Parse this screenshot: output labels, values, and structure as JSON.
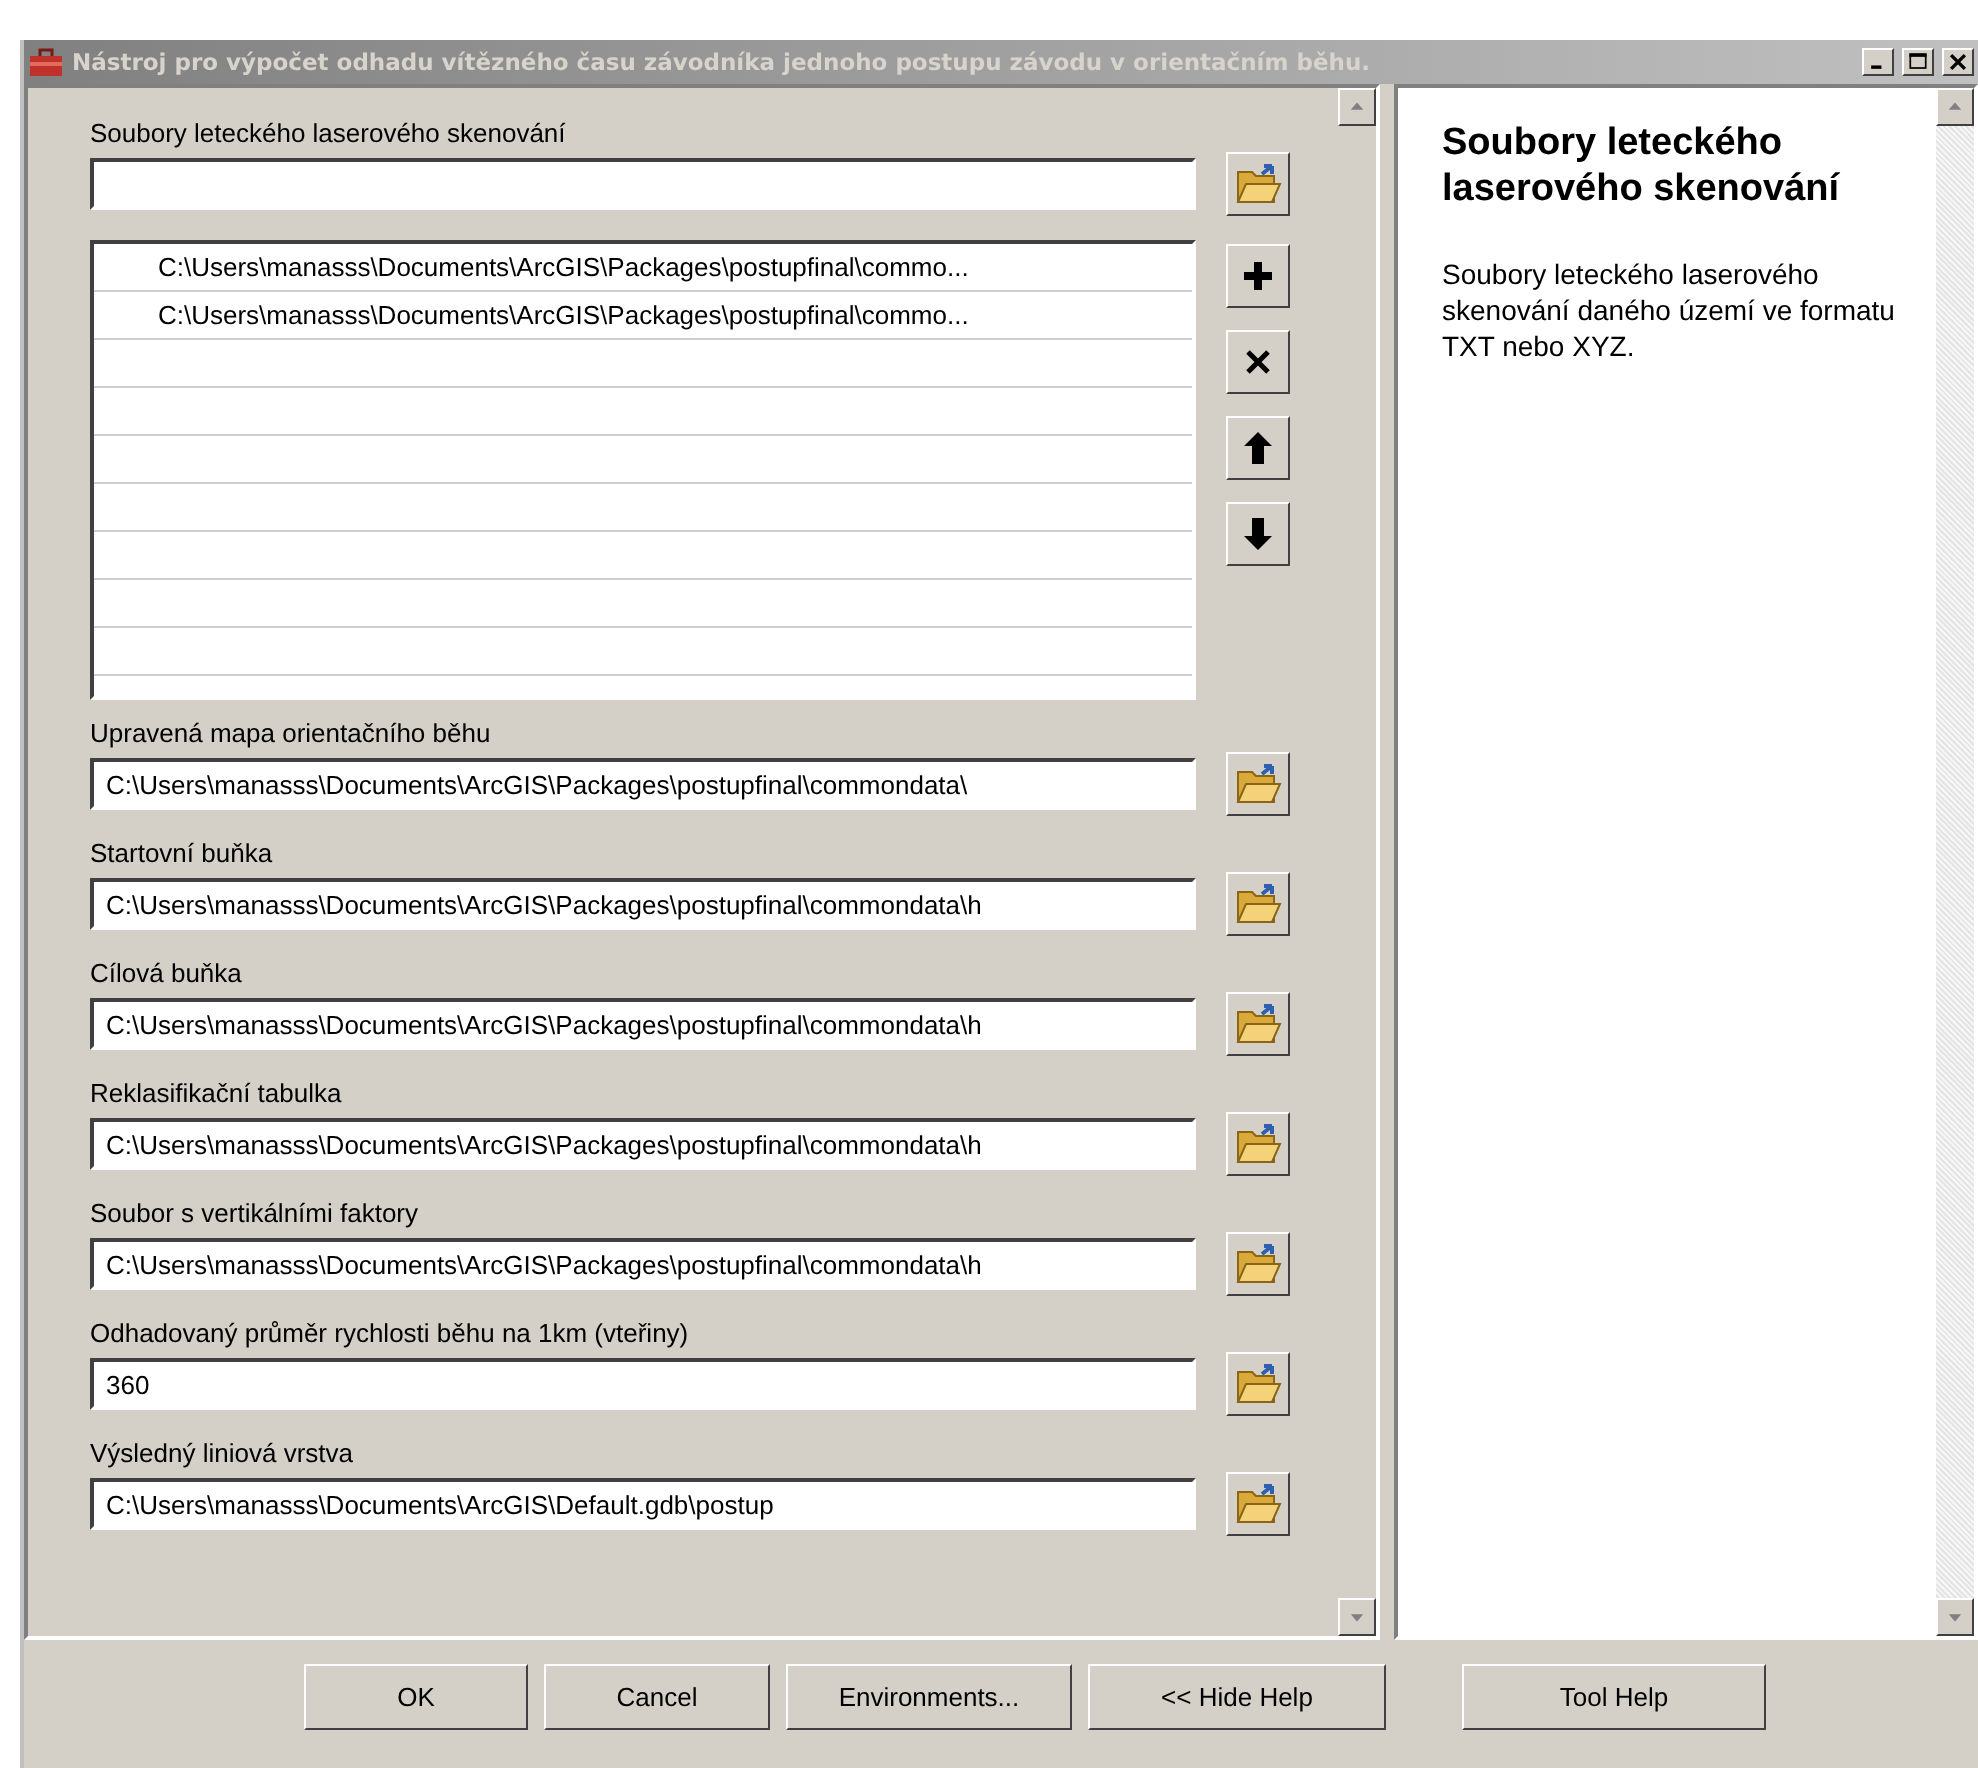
{
  "window": {
    "title": "Nástroj pro výpočet odhadu vítězného času závodníka jednoho postupu závodu v orientačním běhu."
  },
  "list_parameter": {
    "label": "Soubory leteckého laserového skenování",
    "items": [
      "C:\\Users\\manasss\\Documents\\ArcGIS\\Packages\\postupfinal\\commo...",
      "C:\\Users\\manasss\\Documents\\ArcGIS\\Packages\\postupfinal\\commo..."
    ]
  },
  "parameters": [
    {
      "label": "Upravená mapa orientačního běhu",
      "value": "C:\\Users\\manasss\\Documents\\ArcGIS\\Packages\\postupfinal\\commondata\\"
    },
    {
      "label": "Startovní buňka",
      "value": "C:\\Users\\manasss\\Documents\\ArcGIS\\Packages\\postupfinal\\commondata\\h"
    },
    {
      "label": "Cílová buňka",
      "value": "C:\\Users\\manasss\\Documents\\ArcGIS\\Packages\\postupfinal\\commondata\\h"
    },
    {
      "label": "Reklasifikační tabulka",
      "value": "C:\\Users\\manasss\\Documents\\ArcGIS\\Packages\\postupfinal\\commondata\\h"
    },
    {
      "label": "Soubor s vertikálními faktory",
      "value": "C:\\Users\\manasss\\Documents\\ArcGIS\\Packages\\postupfinal\\commondata\\h"
    },
    {
      "label": "Odhadovaný průměr rychlosti běhu na 1km (vteřiny)",
      "value": "360"
    },
    {
      "label": "Výsledný liniová vrstva",
      "value": "C:\\Users\\manasss\\Documents\\ArcGIS\\Default.gdb\\postup"
    }
  ],
  "help": {
    "title": "Soubory leteckého laserového skenování",
    "text": "Soubory leteckého laserového skenování daného území ve formatu TXT nebo XYZ."
  },
  "buttons": [
    {
      "label": "OK"
    },
    {
      "label": "Cancel"
    },
    {
      "label": "Environments..."
    },
    {
      "label": "<< Hide Help"
    }
  ],
  "tool_help_button": {
    "label": "Tool Help"
  }
}
